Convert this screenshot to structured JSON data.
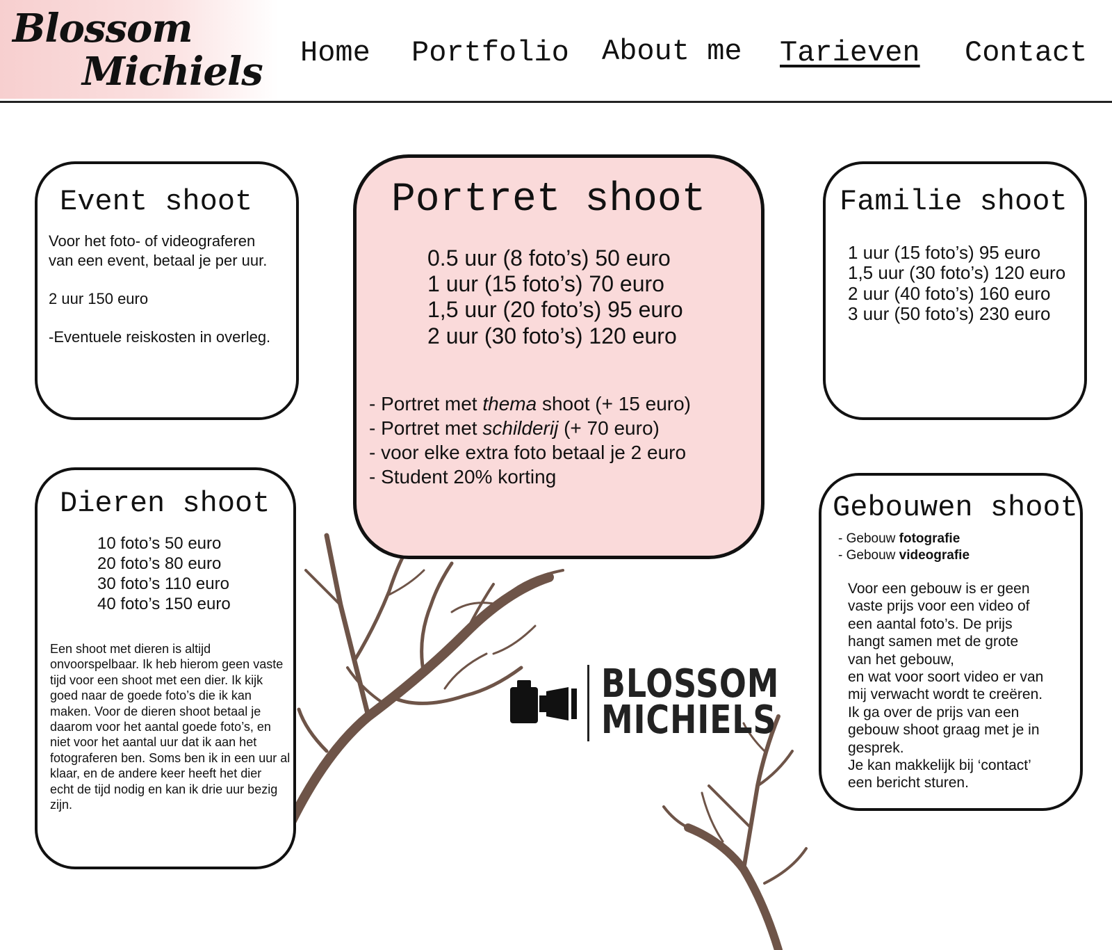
{
  "header": {
    "logo_line1": "Blossom",
    "logo_line2": "Michiels",
    "nav": [
      {
        "label": "Home",
        "active": false
      },
      {
        "label": "Portfolio",
        "active": false
      },
      {
        "label": "About me",
        "active": false
      },
      {
        "label": "Tarieven",
        "active": true
      },
      {
        "label": "Contact",
        "active": false
      }
    ]
  },
  "event": {
    "title": "Event shoot",
    "intro_1": "Voor het foto- of videograferen",
    "intro_2": "van een event, betaal je per uur.",
    "price": "2 uur 150 euro",
    "note": "-Eventuele reiskosten in overleg."
  },
  "portret": {
    "title": "Portret shoot",
    "prices": [
      "0.5 uur (8 foto’s) 50 euro",
      "1 uur (15 foto’s) 70 euro",
      "1,5 uur (20 foto’s) 95 euro",
      "2 uur (30 foto’s) 120 euro"
    ],
    "extras": {
      "thema_prefix": "- Portret met ",
      "thema_em": "thema",
      "thema_suffix": " shoot (+ 15 euro)",
      "schilderij_prefix": "- Portret met ",
      "schilderij_em": "schilderij",
      "schilderij_suffix": " (+ 70 euro)",
      "extra_foto": "- voor elke extra foto betaal je 2 euro",
      "student": "- Student 20% korting"
    }
  },
  "familie": {
    "title": "Familie shoot",
    "prices": [
      "1 uur (15 foto’s)  95 euro",
      "1,5 uur (30 foto’s) 120 euro",
      "2 uur (40 foto’s) 160 euro",
      "3 uur (50 foto’s) 230 euro"
    ]
  },
  "dieren": {
    "title": "Dieren shoot",
    "prices": [
      "10 foto’s 50 euro",
      "20 foto’s 80 euro",
      "30 foto’s 110 euro",
      "40 foto’s 150 euro"
    ],
    "description": "Een shoot met dieren is altijd onvoorspelbaar. Ik heb hierom geen vaste tijd voor een shoot met een dier. Ik kijk goed naar de goede foto’s die ik kan maken. Voor de dieren shoot betaal je daarom voor het aantal goede foto’s, en niet voor het aantal uur dat ik aan het fotograferen ben. Soms ben ik in een uur al klaar, en de andere keer heeft het dier",
    "description_2": "echt de tijd nodig en kan ik drie uur bezig zijn."
  },
  "gebouwen": {
    "title": "Gebouwen shoot",
    "item1_prefix": "- Gebouw ",
    "item1_bold": "fotografie",
    "item2_prefix": "- Gebouw ",
    "item2_bold": "videografie",
    "lines": [
      "Voor een gebouw is er geen",
      "vaste prijs voor een video of",
      "een aantal foto’s. De prijs",
      "hangt samen met de grote",
      "van het gebouw,",
      "en wat voor soort video er van",
      "mij verwacht wordt te creëren.",
      "Ik ga over de prijs van een",
      "gebouw shoot graag met je in",
      "gesprek.",
      "Je kan makkelijk bij ‘contact’",
      "een bericht sturen."
    ]
  },
  "brand": {
    "line1": "BLOSSOM",
    "line2": "MICHIELS"
  },
  "colors": {
    "portret_bg": "#fadada",
    "tree_brown": "#6e5448",
    "logo_pink": "#f7cfcf"
  }
}
